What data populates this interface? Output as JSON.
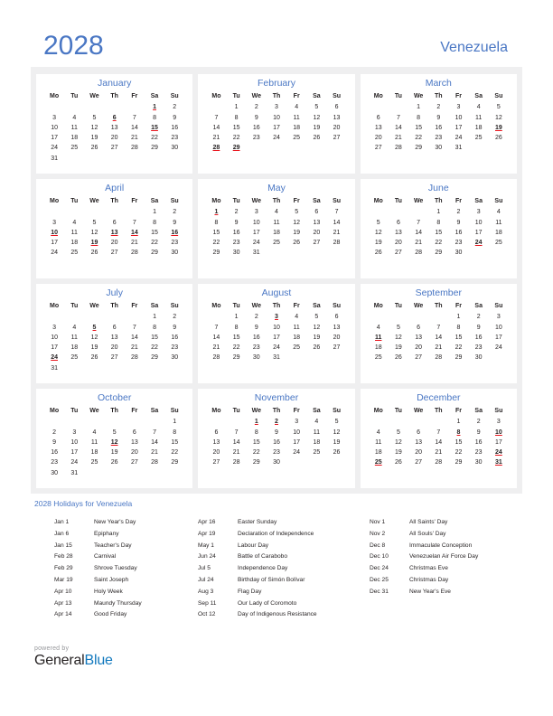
{
  "header": {
    "year": "2028",
    "country": "Venezuela"
  },
  "colors": {
    "accent_blue": "#4a77c4",
    "holiday_red": "#e8141c",
    "band_background": "#efeff0",
    "brand_blue": "#1178be",
    "text": "#231f20"
  },
  "weekday_headers": [
    "Mo",
    "Tu",
    "We",
    "Th",
    "Fr",
    "Sa",
    "Su"
  ],
  "calendar": {
    "months": [
      {
        "name": "January",
        "lead_blanks": 5,
        "days_in_month": 31,
        "holidays": [
          1,
          6,
          15
        ]
      },
      {
        "name": "February",
        "lead_blanks": 1,
        "days_in_month": 29,
        "holidays": [
          28,
          29
        ]
      },
      {
        "name": "March",
        "lead_blanks": 2,
        "days_in_month": 31,
        "holidays": [
          19
        ]
      },
      {
        "name": "April",
        "lead_blanks": 5,
        "days_in_month": 30,
        "holidays": [
          10,
          13,
          14,
          16,
          19
        ]
      },
      {
        "name": "May",
        "lead_blanks": 0,
        "days_in_month": 31,
        "holidays": [
          1
        ]
      },
      {
        "name": "June",
        "lead_blanks": 3,
        "days_in_month": 30,
        "holidays": [
          24
        ]
      },
      {
        "name": "July",
        "lead_blanks": 5,
        "days_in_month": 31,
        "holidays": [
          5,
          24
        ]
      },
      {
        "name": "August",
        "lead_blanks": 1,
        "days_in_month": 31,
        "holidays": [
          3
        ]
      },
      {
        "name": "September",
        "lead_blanks": 4,
        "days_in_month": 30,
        "holidays": [
          11
        ]
      },
      {
        "name": "October",
        "lead_blanks": 6,
        "days_in_month": 31,
        "holidays": [
          12
        ]
      },
      {
        "name": "November",
        "lead_blanks": 2,
        "days_in_month": 30,
        "holidays": [
          1,
          2
        ]
      },
      {
        "name": "December",
        "lead_blanks": 4,
        "days_in_month": 31,
        "holidays": [
          8,
          10,
          24,
          25,
          31
        ]
      }
    ]
  },
  "holidays_list": {
    "title": "2028 Holidays for Venezuela",
    "columns": [
      [
        {
          "date": "Jan 1",
          "name": "New Year's Day"
        },
        {
          "date": "Jan 6",
          "name": "Epiphany"
        },
        {
          "date": "Jan 15",
          "name": "Teacher's Day"
        },
        {
          "date": "Feb 28",
          "name": "Carnival"
        },
        {
          "date": "Feb 29",
          "name": "Shrove Tuesday"
        },
        {
          "date": "Mar 19",
          "name": "Saint Joseph"
        },
        {
          "date": "Apr 10",
          "name": "Holy Week"
        },
        {
          "date": "Apr 13",
          "name": "Maundy Thursday"
        },
        {
          "date": "Apr 14",
          "name": "Good Friday"
        }
      ],
      [
        {
          "date": "Apr 16",
          "name": "Easter Sunday"
        },
        {
          "date": "Apr 19",
          "name": "Declaration of Independence"
        },
        {
          "date": "May 1",
          "name": "Labour Day"
        },
        {
          "date": "Jun 24",
          "name": "Battle of Carabobo"
        },
        {
          "date": "Jul 5",
          "name": "Independence Day"
        },
        {
          "date": "Jul 24",
          "name": "Birthday of Simón Bolívar"
        },
        {
          "date": "Aug 3",
          "name": "Flag Day"
        },
        {
          "date": "Sep 11",
          "name": "Our Lady of Coromoto"
        },
        {
          "date": "Oct 12",
          "name": "Day of Indigenous Resistance"
        }
      ],
      [
        {
          "date": "Nov 1",
          "name": "All Saints' Day"
        },
        {
          "date": "Nov 2",
          "name": "All Souls' Day"
        },
        {
          "date": "Dec 8",
          "name": "Immaculate Conception"
        },
        {
          "date": "Dec 10",
          "name": "Venezuelan Air Force Day"
        },
        {
          "date": "Dec 24",
          "name": "Christmas Eve"
        },
        {
          "date": "Dec 25",
          "name": "Christmas Day"
        },
        {
          "date": "Dec 31",
          "name": "New Year's Eve"
        }
      ]
    ]
  },
  "footer": {
    "powered_by": "powered by",
    "brand_part1": "General",
    "brand_part2": "Blue"
  }
}
